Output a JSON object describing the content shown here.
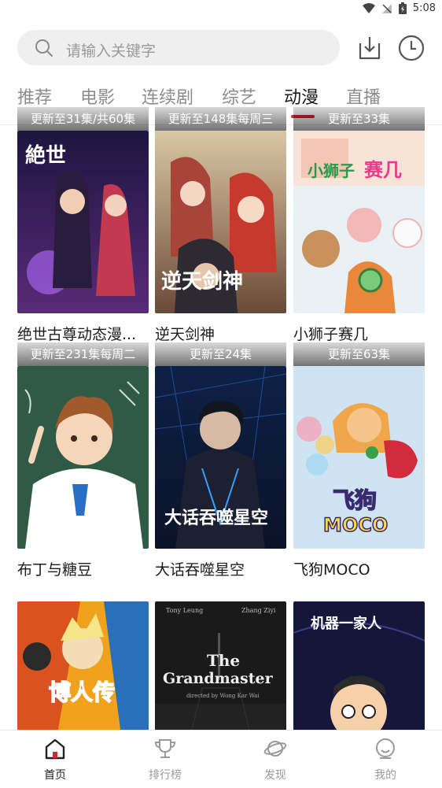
{
  "status_bar": {
    "time": "5:08"
  },
  "search": {
    "placeholder": "请输入关键字"
  },
  "tabs": [
    {
      "label": "推荐",
      "active": false
    },
    {
      "label": "电影",
      "active": false
    },
    {
      "label": "连续剧",
      "active": false
    },
    {
      "label": "综艺",
      "active": false
    },
    {
      "label": "动漫",
      "active": true
    },
    {
      "label": "直播",
      "active": false
    }
  ],
  "cards": [
    {
      "title": "绝世古尊动态漫...",
      "badge": "更新至31集/共60集"
    },
    {
      "title": "逆天剑神",
      "badge": "更新至148集每周三"
    },
    {
      "title": "小狮子赛几",
      "badge": "更新至33集"
    },
    {
      "title": "布丁与糖豆",
      "badge": "更新至231集每周二"
    },
    {
      "title": "大话吞噬星空",
      "badge": "更新至24集"
    },
    {
      "title": "飞狗MOCO",
      "badge": "更新至63集"
    },
    {
      "title": "",
      "badge": ""
    },
    {
      "title": "",
      "badge": ""
    },
    {
      "title": "",
      "badge": ""
    }
  ],
  "bottom_nav": [
    {
      "label": "首页",
      "icon": "home-icon",
      "active": true
    },
    {
      "label": "排行榜",
      "icon": "trophy-icon",
      "active": false
    },
    {
      "label": "发现",
      "icon": "planet-icon",
      "active": false
    },
    {
      "label": "我的",
      "icon": "user-icon",
      "active": false
    }
  ],
  "colors": {
    "accent": "#d92535",
    "search_bg": "#efefef",
    "inactive_text": "#8c8c8c"
  }
}
